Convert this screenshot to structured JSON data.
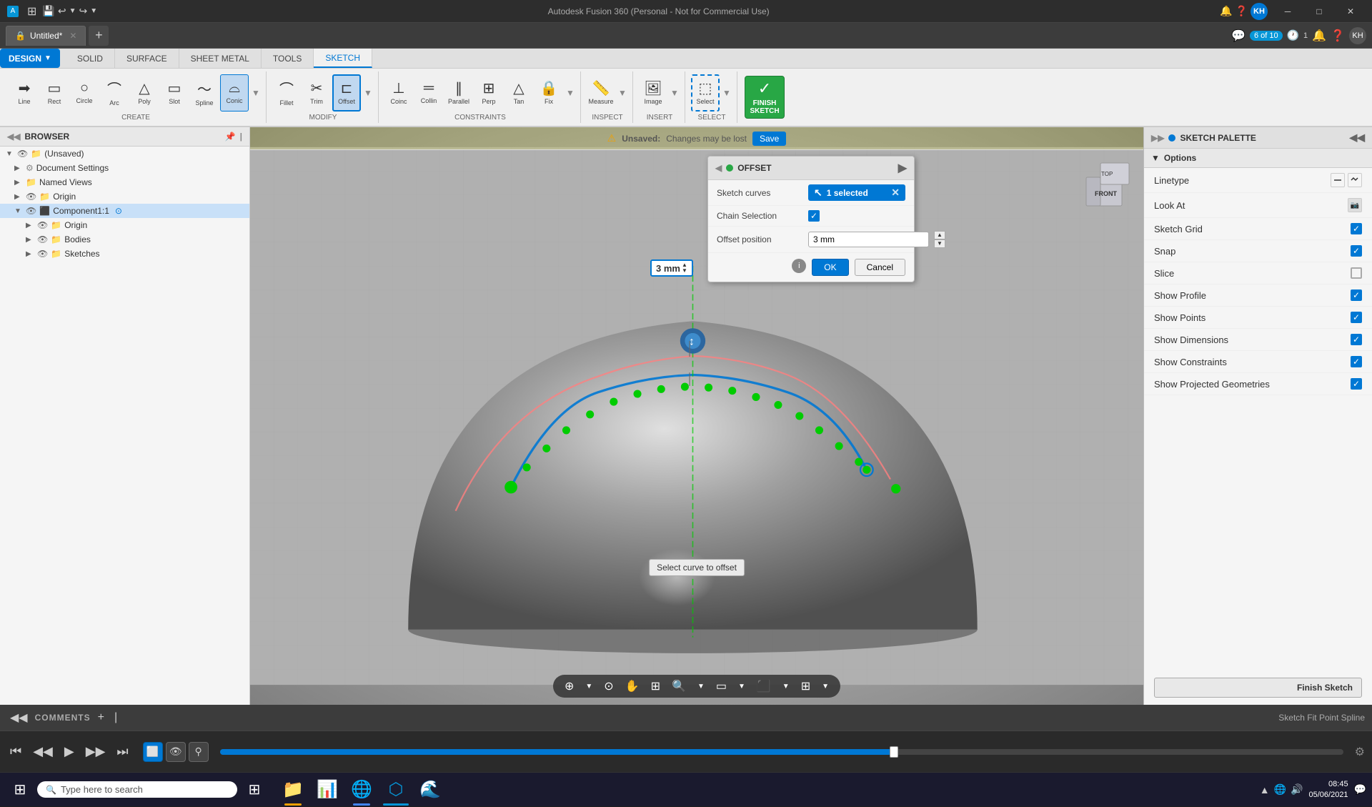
{
  "titlebar": {
    "app_name": "Autodesk Fusion 360 (Personal - Not for Commercial Use)",
    "tab_title": "Untitled*",
    "tab_count": "6 of 10",
    "timer": "1",
    "user_initials": "KH"
  },
  "ribbon": {
    "tabs": [
      "SOLID",
      "SURFACE",
      "SHEET METAL",
      "TOOLS",
      "SKETCH"
    ],
    "active_tab": "SKETCH",
    "design_btn": "DESIGN",
    "sections": {
      "create_label": "CREATE",
      "modify_label": "MODIFY",
      "constraints_label": "CONSTRAINTS",
      "inspect_label": "INSPECT",
      "insert_label": "INSERT",
      "select_label": "SELECT",
      "finish_sketch_label": "FINISH SKETCH"
    }
  },
  "warning_bar": {
    "icon": "⚠",
    "label": "Unsaved:",
    "message": "Changes may be lost",
    "save_btn": "Save"
  },
  "browser": {
    "title": "BROWSER",
    "items": [
      {
        "label": "(Unsaved)",
        "indent": 0,
        "expanded": true,
        "has_eye": true
      },
      {
        "label": "Document Settings",
        "indent": 1,
        "expanded": false,
        "has_eye": false
      },
      {
        "label": "Named Views",
        "indent": 1,
        "expanded": false,
        "has_eye": false
      },
      {
        "label": "Origin",
        "indent": 1,
        "expanded": false,
        "has_eye": true
      },
      {
        "label": "Component1:1",
        "indent": 1,
        "expanded": true,
        "has_eye": true,
        "highlighted": true
      },
      {
        "label": "Origin",
        "indent": 2,
        "expanded": false,
        "has_eye": true
      },
      {
        "label": "Bodies",
        "indent": 2,
        "expanded": false,
        "has_eye": true
      },
      {
        "label": "Sketches",
        "indent": 2,
        "expanded": false,
        "has_eye": true
      }
    ]
  },
  "offset_panel": {
    "title": "OFFSET",
    "sketch_curves_label": "Sketch curves",
    "sketch_curves_value": "1 selected",
    "chain_selection_label": "Chain Selection",
    "chain_selection_checked": true,
    "offset_position_label": "Offset position",
    "offset_position_value": "3 mm",
    "ok_btn": "OK",
    "cancel_btn": "Cancel"
  },
  "sketch_palette": {
    "title": "SKETCH PALETTE",
    "options_section": "Options",
    "rows": [
      {
        "label": "Linetype",
        "has_icons": true,
        "checked": null
      },
      {
        "label": "Look At",
        "has_lookat": true,
        "checked": null
      },
      {
        "label": "Sketch Grid",
        "checked": true
      },
      {
        "label": "Snap",
        "checked": true
      },
      {
        "label": "Slice",
        "checked": false
      },
      {
        "label": "Show Profile",
        "checked": true
      },
      {
        "label": "Show Points",
        "checked": true
      },
      {
        "label": "Show Dimensions",
        "checked": true
      },
      {
        "label": "Show Constraints",
        "checked": true
      },
      {
        "label": "Show Projected Geometries",
        "checked": true
      }
    ],
    "finish_sketch_btn": "Finish Sketch"
  },
  "viewport": {
    "tooltip": "Select curve to offset",
    "offset_display": "3 mm",
    "view_label": "FRONT"
  },
  "timeline": {
    "play_controls": [
      "⏮",
      "◀◀",
      "▶",
      "▶▶",
      "⏭"
    ],
    "mode_icons": [
      "⬜",
      "⬜",
      "⬜"
    ]
  },
  "status_bar": {
    "label": "Sketch Fit Point Spline"
  },
  "comments": {
    "label": "COMMENTS"
  },
  "taskbar": {
    "search_placeholder": "Type here to search",
    "apps": [
      {
        "name": "File Explorer",
        "color": "#f0a000",
        "icon": "📁"
      },
      {
        "name": "RAM",
        "color": "#666",
        "icon": "📊"
      },
      {
        "name": "Chrome",
        "color": "#4285f4",
        "icon": "🌐"
      },
      {
        "name": "Fusion360",
        "color": "#0696d7",
        "icon": "⬡"
      },
      {
        "name": "Edge",
        "color": "#0078d4",
        "icon": "🌊"
      }
    ],
    "tray": {
      "time": "08:45",
      "date": "05/06/2021"
    }
  }
}
